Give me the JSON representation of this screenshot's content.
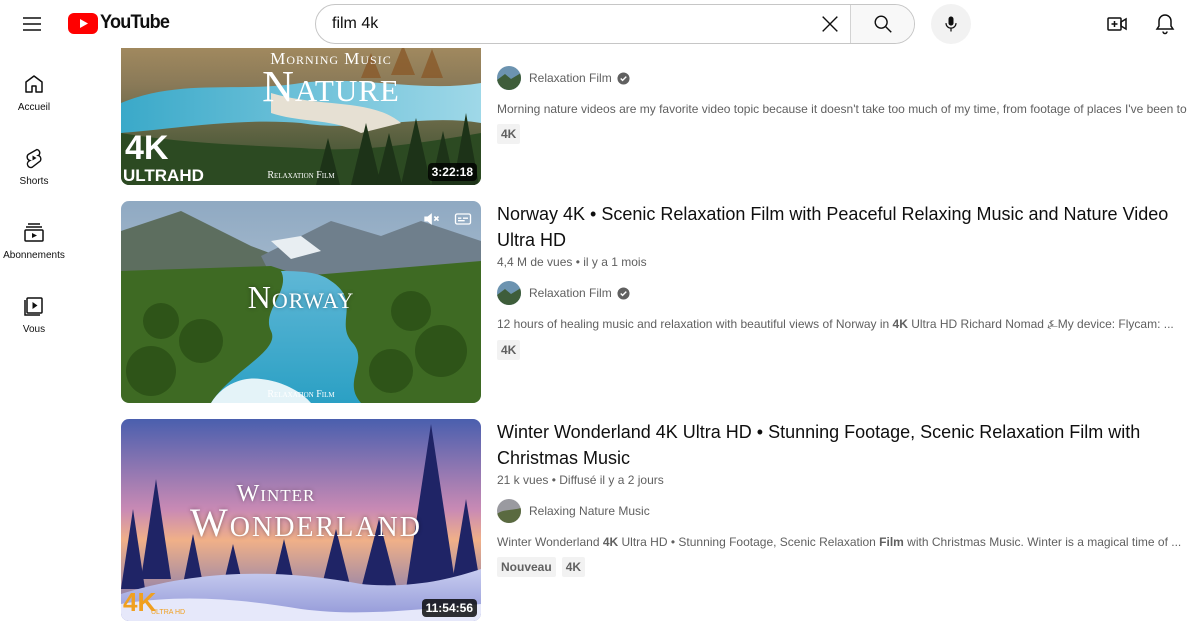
{
  "header": {
    "logo_text": "YouTube",
    "search_value": "film 4k",
    "icons": {
      "menu": "hamburger-icon",
      "clear": "close-icon",
      "search": "search-icon",
      "mic": "microphone-icon",
      "create": "create-video-icon",
      "notifications": "bell-icon"
    }
  },
  "guide": [
    {
      "label": "Accueil",
      "icon": "home-icon"
    },
    {
      "label": "Shorts",
      "icon": "shorts-icon"
    },
    {
      "label": "Abonnements",
      "icon": "subscriptions-icon"
    },
    {
      "label": "Vous",
      "icon": "you-icon"
    }
  ],
  "results": [
    {
      "thumb_top_text": "Morning Music",
      "thumb_main_text": "Nature",
      "thumb_badge_big": "4K",
      "thumb_badge_small": "ULTRAHD",
      "thumb_watermark": "Relaxation Film",
      "duration": "3:22:18",
      "channel": "Relaxation Film",
      "description": "Morning nature videos are my favorite video topic because it doesn't take too much of my time, from footage of places I've been to",
      "badges": [
        "4K"
      ]
    },
    {
      "thumb_main_text": "Norway",
      "thumb_watermark": "Relaxation Film",
      "title": "Norway 4K • Scenic Relaxation Film with Peaceful Relaxing Music and Nature Video Ultra HD",
      "views": "4,4 M de vues",
      "age": "il y a 1 mois",
      "channel": "Relaxation Film",
      "description_pre": "12 hours of healing music and relaxation with beautiful views of Norway in ",
      "description_bold": "4K",
      "description_post": " Ultra HD Richard Nomad ⍼My device: Flycam: ...",
      "badges": [
        "4K"
      ]
    },
    {
      "thumb_top_text": "Winter",
      "thumb_main_text": "Wonderland",
      "thumb_badge_big": "4K",
      "thumb_badge_small": "ULTRA HD",
      "duration": "11:54:56",
      "title": "Winter Wonderland 4K Ultra HD • Stunning Footage, Scenic Relaxation Film with Christmas Music",
      "views": "21 k vues",
      "age": "Diffusé il y a 2 jours",
      "channel": "Relaxing Nature Music",
      "description_pre": "Winter Wonderland ",
      "description_bold": "4K",
      "description_mid": " Ultra HD • Stunning Footage, Scenic Relaxation ",
      "description_bold2": "Film",
      "description_post": " with Christmas Music. Winter is a magical time of ...",
      "badges": [
        "Nouveau",
        "4K"
      ]
    }
  ],
  "colors": {
    "brand_red": "#ff0000",
    "text_primary": "#0f0f0f",
    "text_secondary": "#606060"
  }
}
